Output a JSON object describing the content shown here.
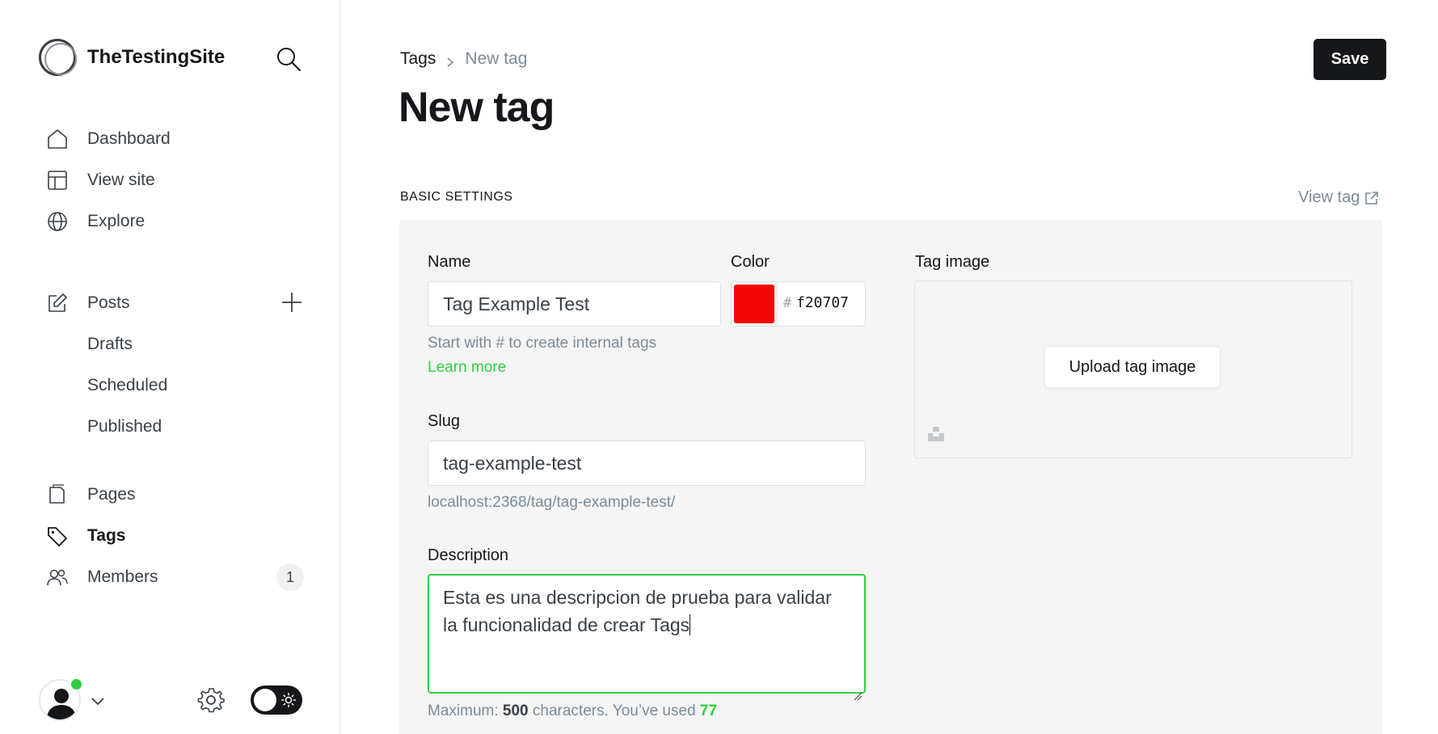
{
  "brand": {
    "name": "TheTestingSite"
  },
  "nav": {
    "main": [
      {
        "label": "Dashboard",
        "icon": "home-icon"
      },
      {
        "label": "View site",
        "icon": "layout-icon"
      },
      {
        "label": "Explore",
        "icon": "globe-icon"
      }
    ],
    "posts": {
      "label": "Posts",
      "icon": "edit-icon"
    },
    "post_subitems": [
      "Drafts",
      "Scheduled",
      "Published"
    ],
    "secondary": [
      {
        "label": "Pages",
        "icon": "pages-icon"
      },
      {
        "label": "Tags",
        "icon": "tag-icon",
        "active": true
      },
      {
        "label": "Members",
        "icon": "members-icon",
        "count": "1"
      }
    ]
  },
  "breadcrumb": {
    "parent": "Tags",
    "current": "New tag"
  },
  "page": {
    "title": "New tag",
    "save_label": "Save"
  },
  "section": {
    "label": "BASIC SETTINGS",
    "view_tag_label": "View tag"
  },
  "form": {
    "name": {
      "label": "Name",
      "value": "Tag Example Test",
      "hint": "Start with # to create internal tags",
      "learn_more": "Learn more"
    },
    "color": {
      "label": "Color",
      "hash": "#",
      "value": "f20707",
      "swatch": "#f20707"
    },
    "slug": {
      "label": "Slug",
      "value": "tag-example-test",
      "url_preview": "localhost:2368/tag/tag-example-test/"
    },
    "description": {
      "label": "Description",
      "line1": "Esta es una descripcion de prueba para validar",
      "line2": "la funcionalidad de crear Tags",
      "counter_prefix": "Maximum:",
      "counter_max": "500",
      "counter_mid": "characters. You’ve used",
      "counter_used": "77"
    },
    "tag_image": {
      "label": "Tag image",
      "upload_label": "Upload tag image"
    }
  },
  "colors": {
    "accent_green": "#30cf43",
    "dark": "#15171a",
    "muted": "#7c8b9a"
  }
}
